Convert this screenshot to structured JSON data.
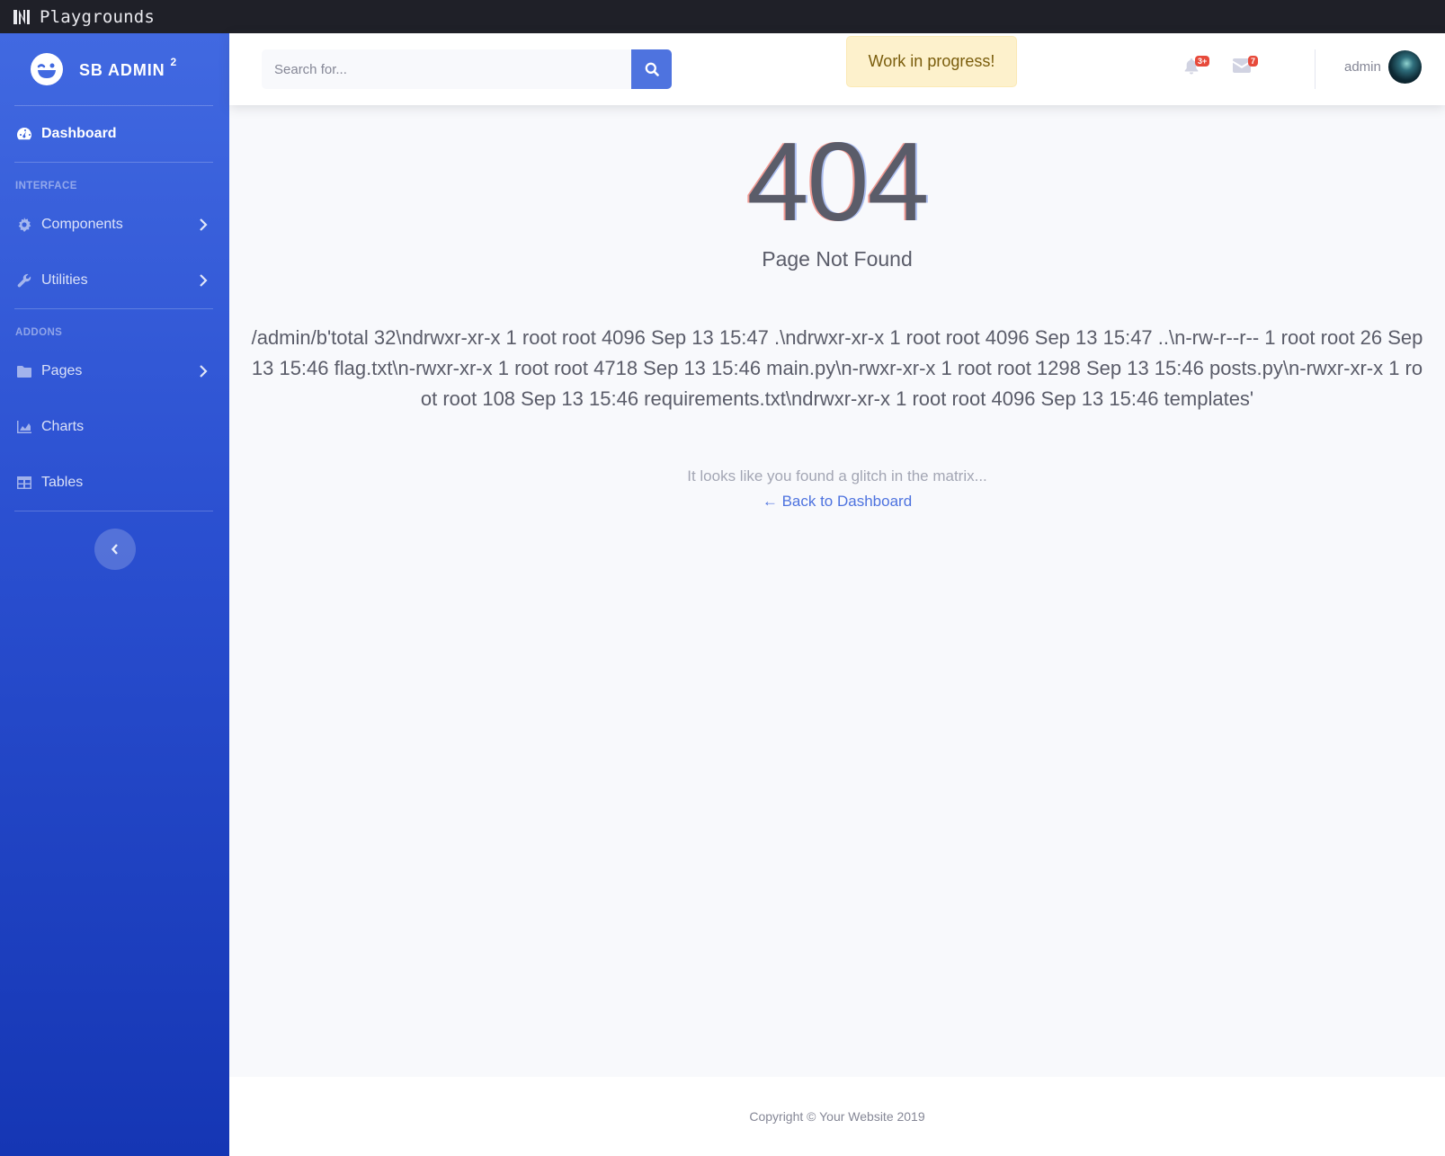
{
  "app_bar": {
    "title": "Playgrounds"
  },
  "sidebar": {
    "brand": {
      "name": "SB ADMIN",
      "superscript": "2"
    },
    "dashboard": {
      "label": "Dashboard",
      "icon": "tachometer-icon"
    },
    "section_interface": "INTERFACE",
    "components": {
      "label": "Components",
      "icon": "cog-icon"
    },
    "utilities": {
      "label": "Utilities",
      "icon": "wrench-icon"
    },
    "section_addons": "ADDONS",
    "pages": {
      "label": "Pages",
      "icon": "folder-icon"
    },
    "charts": {
      "label": "Charts",
      "icon": "area-chart-icon"
    },
    "tables": {
      "label": "Tables",
      "icon": "table-icon"
    }
  },
  "topbar": {
    "search_placeholder": "Search for...",
    "notice": "Work in progress!",
    "alerts_badge": "3+",
    "messages_badge": "7",
    "user_name": "admin"
  },
  "error": {
    "code": "404",
    "title": "Page Not Found",
    "path_output": "/admin/b'total 32\\ndrwxr-xr-x 1 root root 4096 Sep 13 15:47 .\\ndrwxr-xr-x 1 root root 4096 Sep 13 15:47 ..\\n-rw-r--r-- 1 root root 26 Sep 13 15:46 flag.txt\\n-rwxr-xr-x 1 root root 4718 Sep 13 15:46 main.py\\n-rwxr-xr-x 1 root root 1298 Sep 13 15:46 posts.py\\n-rwxr-xr-x 1 root root 108 Sep 13 15:46 requirements.txt\\ndrwxr-xr-x 1 root root 4096 Sep 13 15:46 templates'",
    "glitch_text": "It looks like you found a glitch in the matrix...",
    "back_link": "← Back to Dashboard"
  },
  "footer": {
    "copyright": "Copyright © Your Website 2019"
  },
  "colors": {
    "primary": "#4e73df",
    "danger": "#e74a3b",
    "warning_bg": "#fdf1cc"
  }
}
